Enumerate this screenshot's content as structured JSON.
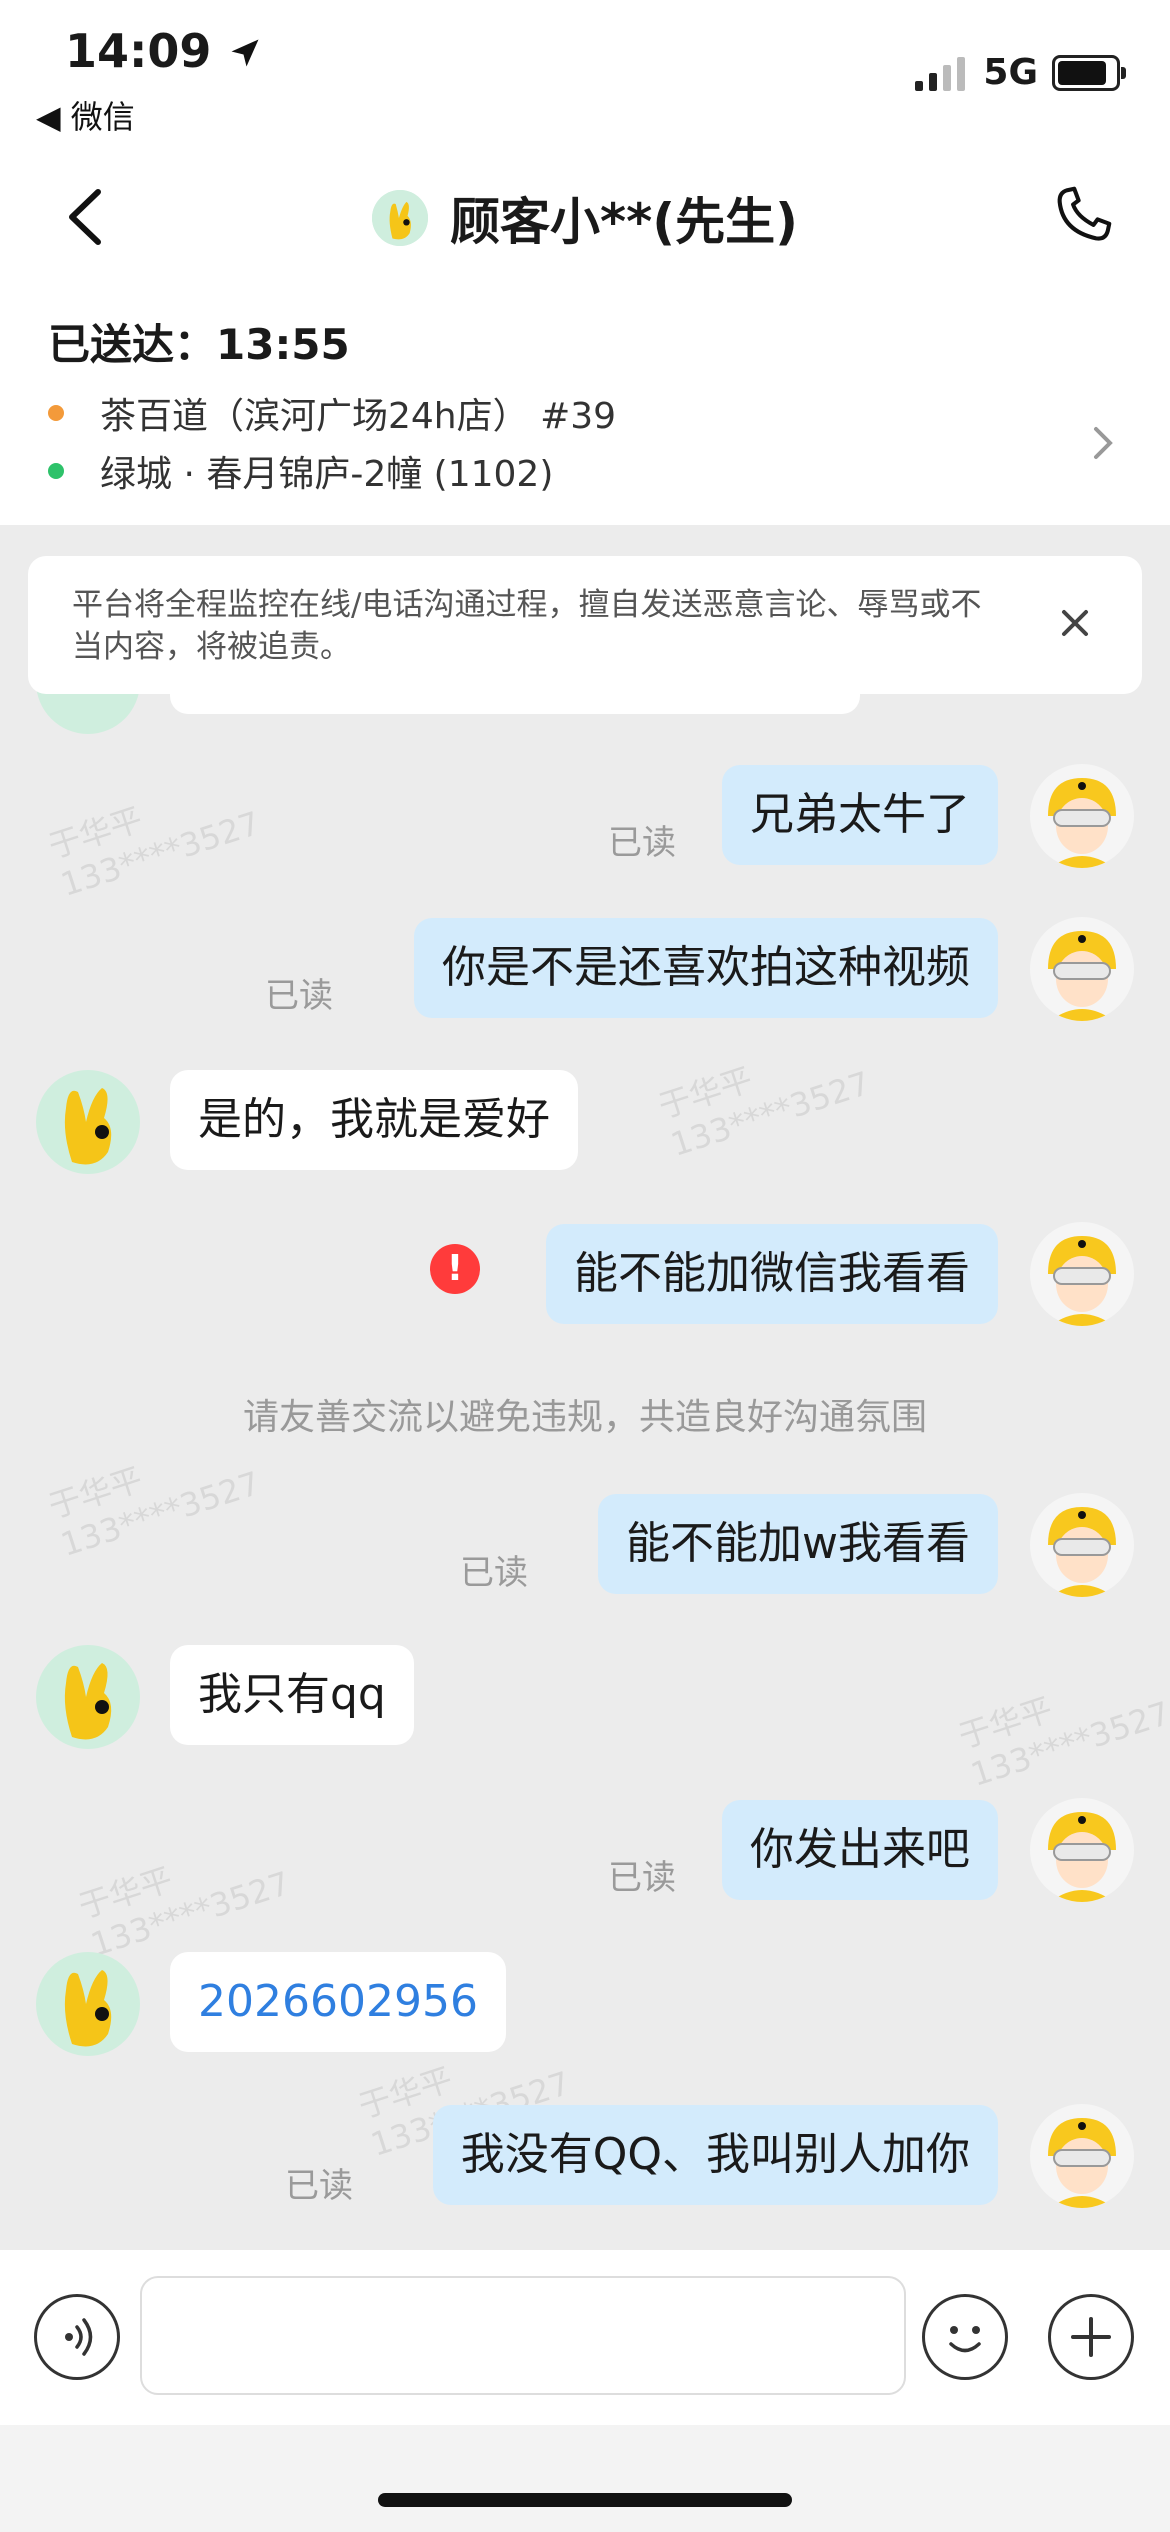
{
  "status_bar": {
    "time": "14:09",
    "back_app": "◀ 微信",
    "network": "5G",
    "battery_percent": 85
  },
  "nav": {
    "title": "顾客小**(先生)"
  },
  "order": {
    "delivered_label": "已送达：13:55",
    "store": "茶百道（滨河广场24h店） #39",
    "address": "绿城 · 春月锦庐-2幢 (1102)",
    "colors": {
      "store_dot": "#f39a3a",
      "address_dot": "#2ec26a"
    }
  },
  "notice": {
    "text": "平台将全程监控在线/电话沟通过程，擅自发送恶意言论、辱骂或不当内容，将被追责。"
  },
  "messages": [
    {
      "side": "mine",
      "text": "兄弟太牛了",
      "status": "已读"
    },
    {
      "side": "mine",
      "text": "你是不是还喜欢拍这种视频",
      "status": "已读"
    },
    {
      "side": "theirs",
      "text": "是的，我就是爱好"
    },
    {
      "side": "mine",
      "text": "能不能加微信我看看",
      "status": "failed"
    },
    {
      "side": "mine",
      "text": "能不能加w我看看",
      "status": "已读"
    },
    {
      "side": "theirs",
      "text": "我只有qq"
    },
    {
      "side": "mine",
      "text": "你发出来吧",
      "status": "已读"
    },
    {
      "side": "theirs",
      "text": "2026602956",
      "is_link": true
    },
    {
      "side": "mine",
      "text": "我没有QQ、我叫别人加你",
      "status": "已读"
    }
  ],
  "system_message": "请友善交流以避免违规，共造良好沟通氛围",
  "watermark": {
    "name": "于华平",
    "phone": "133****3527"
  },
  "input": {
    "placeholder": ""
  },
  "icons": [
    "back-arrow-icon",
    "phone-icon",
    "close-icon",
    "chevron-right-icon",
    "voice-icon",
    "emoji-icon",
    "plus-icon",
    "alert-icon",
    "location-arrow-icon",
    "signal-icon",
    "battery-icon"
  ]
}
